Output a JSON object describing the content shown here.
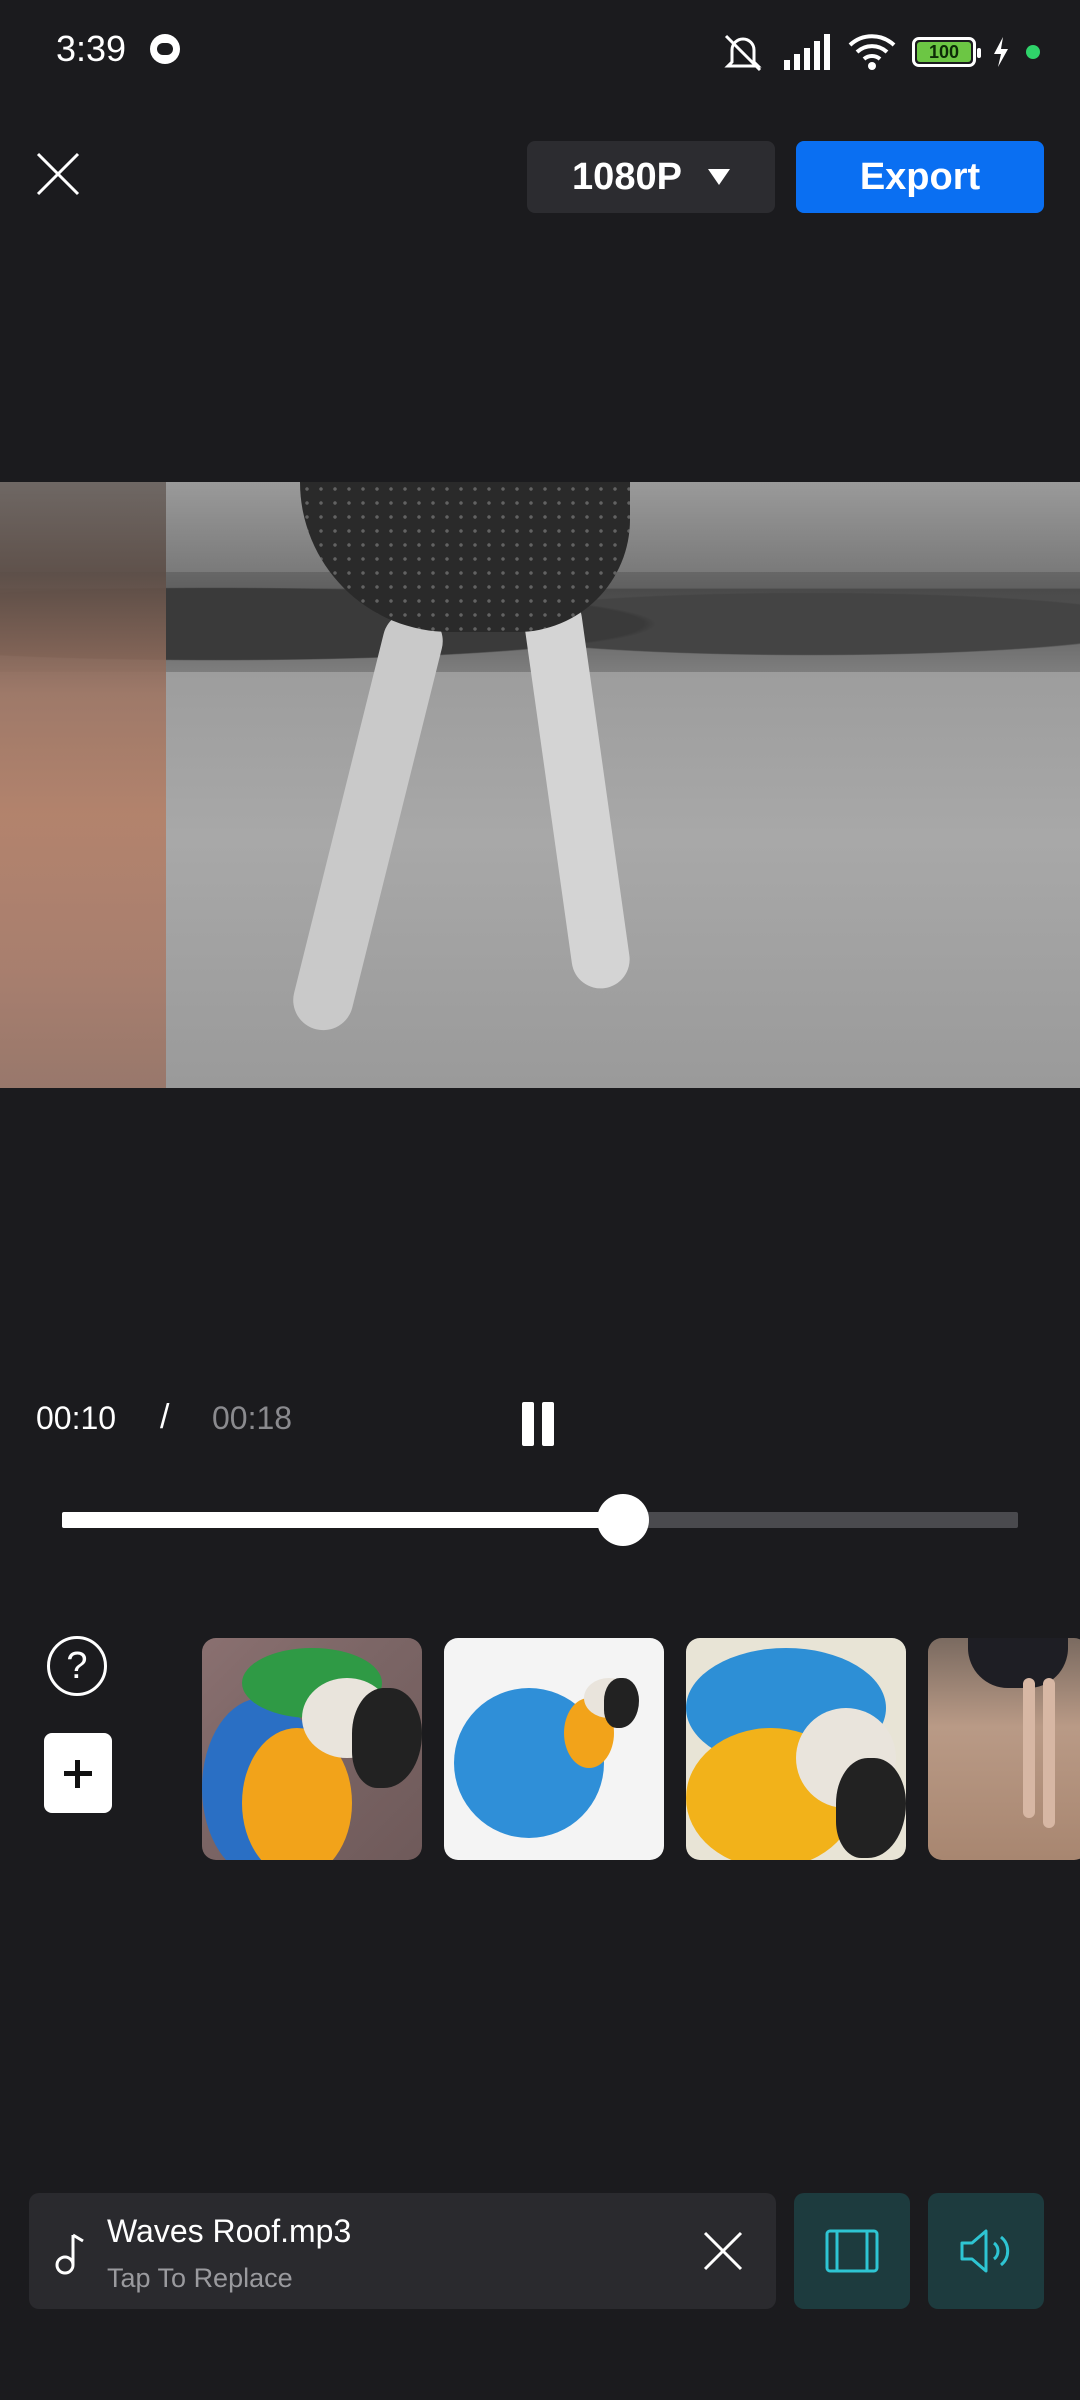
{
  "status_bar": {
    "time": "3:39",
    "battery": "100",
    "icons": [
      "cat-app-icon",
      "mute-bell-icon",
      "signal-icon",
      "wifi-icon",
      "battery-icon",
      "charging-icon",
      "green-dot-icon"
    ]
  },
  "top_bar": {
    "resolution": "1080P",
    "export_label": "Export"
  },
  "playback": {
    "current_time": "00:10",
    "separator": "/",
    "total_time": "00:18",
    "progress": 0.587
  },
  "side_controls": {
    "help_label": "?"
  },
  "music": {
    "title": "Waves Roof.mp3",
    "subtitle": "Tap To Replace"
  },
  "colors": {
    "background": "#1b1b1e",
    "accent": "#0a6ff2",
    "teal_button": "#1d3b3e",
    "teal_icon": "#2ec5d3"
  }
}
